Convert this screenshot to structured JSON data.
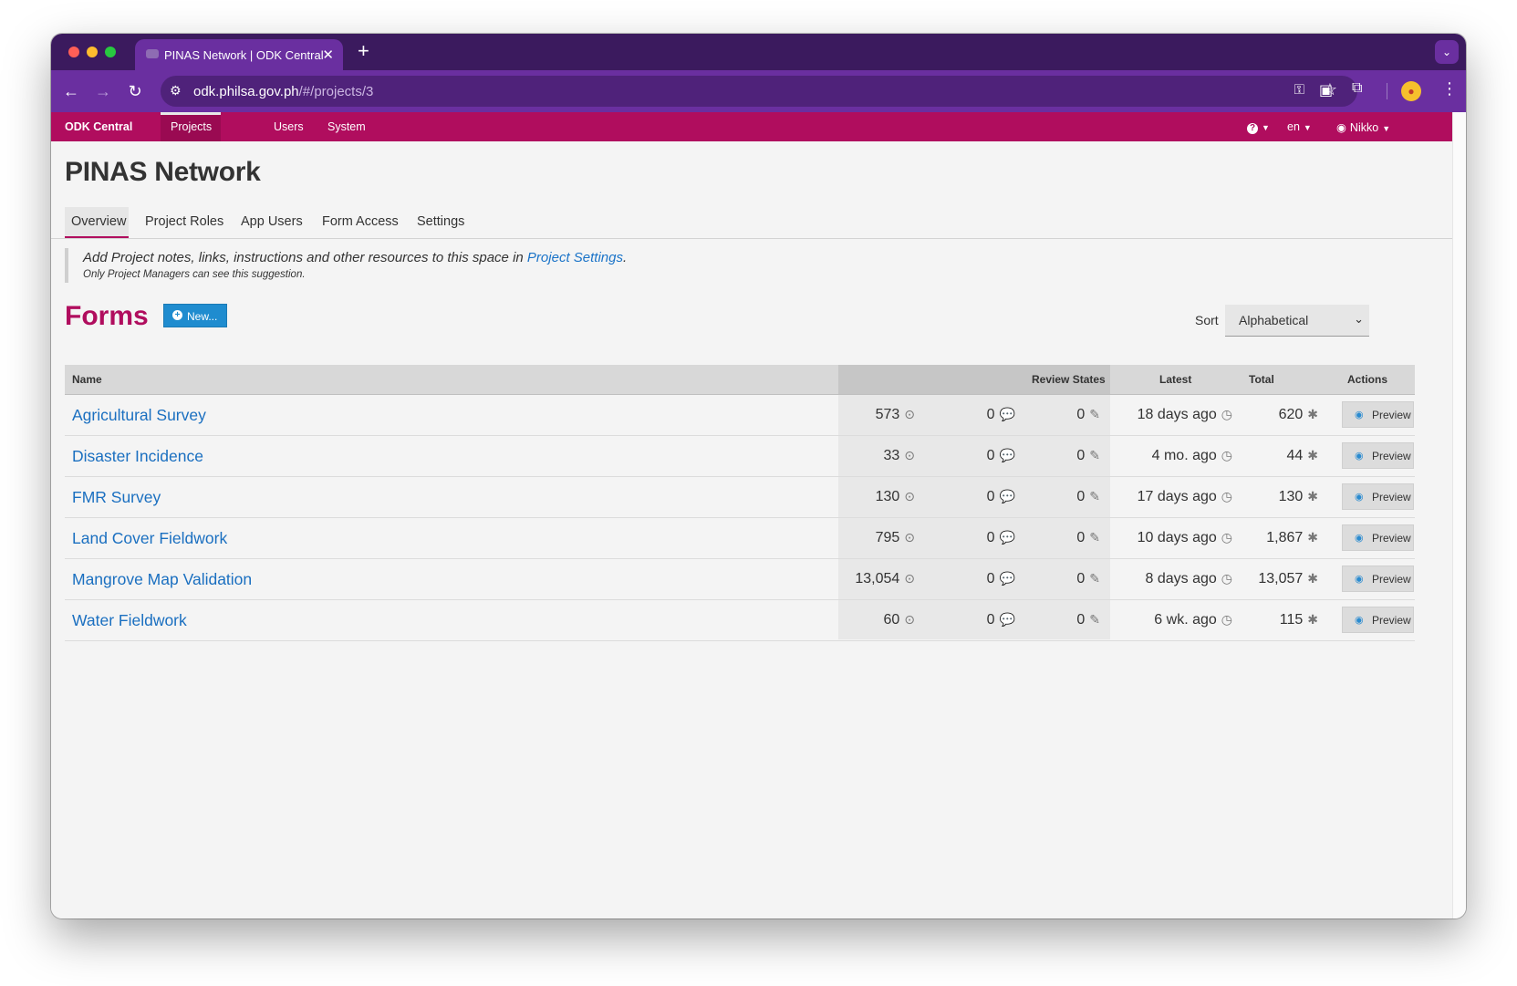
{
  "browser": {
    "tab_title": "PINAS Network | ODK Central",
    "tab_close": "✕",
    "new_tab": "+",
    "url_host": "odk.philsa.gov.ph",
    "url_path": "/#/projects/3",
    "icons": [
      "back-icon",
      "forward-icon",
      "reload-icon",
      "site-settings-icon",
      "key-icon",
      "star-icon",
      "extension-icon",
      "puzzle-icon",
      "profile-avatar",
      "more-icon",
      "tab-search-icon"
    ]
  },
  "navbar": {
    "brand": "ODK Central",
    "projects": "Projects",
    "users": "Users",
    "system": "System",
    "help": "?",
    "lang": "en",
    "user": "Nikko",
    "accent": "#b00d5e"
  },
  "project": {
    "title": "PINAS Network",
    "tabs": [
      "Overview",
      "Project Roles",
      "App Users",
      "Form Access",
      "Settings"
    ],
    "active_tab": "Overview"
  },
  "notes": {
    "text_before": "Add Project notes, links, instructions and other resources to this space in ",
    "link": "Project Settings",
    "text_after": ".",
    "sub": "Only Project Managers can see this suggestion."
  },
  "forms": {
    "title": "Forms",
    "new_button": "New...",
    "sort_label": "Sort",
    "sort_value": "Alphabetical",
    "columns": {
      "name": "Name",
      "review_states": "Review States",
      "latest": "Latest",
      "total": "Total",
      "actions": "Actions"
    },
    "preview_label": "Preview",
    "rows": [
      {
        "name": "Agricultural Survey",
        "received": "573",
        "comments": "0",
        "edited": "0",
        "latest": "18 days ago",
        "total": "620"
      },
      {
        "name": "Disaster Incidence",
        "received": "33",
        "comments": "0",
        "edited": "0",
        "latest": "4 mo. ago",
        "total": "44"
      },
      {
        "name": "FMR Survey",
        "received": "130",
        "comments": "0",
        "edited": "0",
        "latest": "17 days ago",
        "total": "130"
      },
      {
        "name": "Land Cover Fieldwork",
        "received": "795",
        "comments": "0",
        "edited": "0",
        "latest": "10 days ago",
        "total": "1,867"
      },
      {
        "name": "Mangrove Map Validation",
        "received": "13,054",
        "comments": "0",
        "edited": "0",
        "latest": "8 days ago",
        "total": "13,057"
      },
      {
        "name": "Water Fieldwork",
        "received": "60",
        "comments": "0",
        "edited": "0",
        "latest": "6 wk. ago",
        "total": "115"
      }
    ]
  }
}
